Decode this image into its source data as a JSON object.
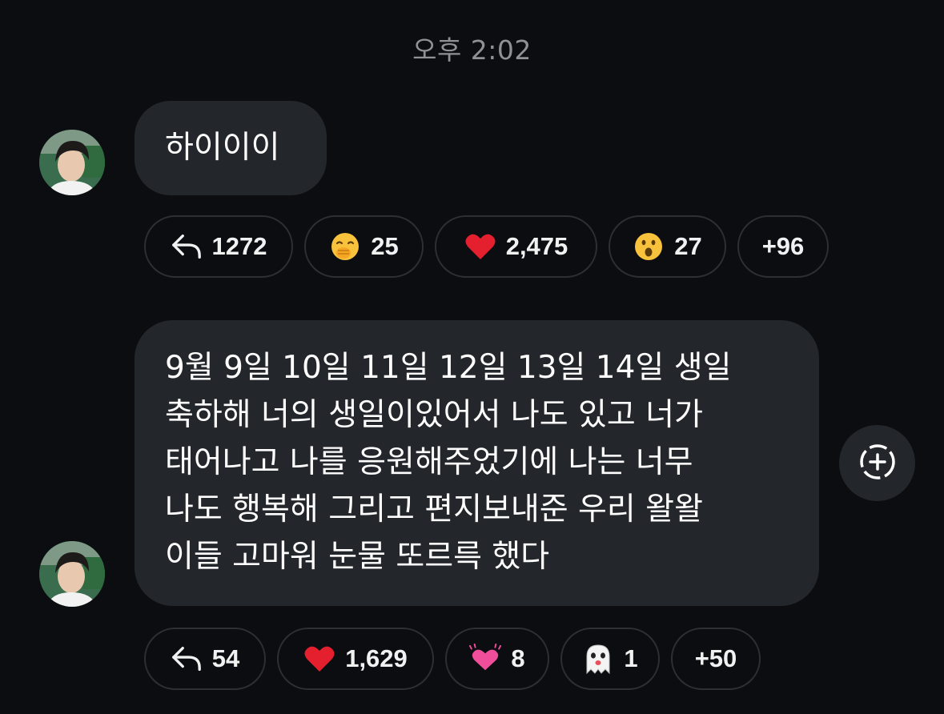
{
  "timestamp": "오후 2:02",
  "messages": [
    {
      "text": "하이이이",
      "reactions": [
        {
          "icon": "reply-arrow-icon",
          "count": "1272"
        },
        {
          "icon": "face-with-hand-over-mouth-emoji",
          "count": "25"
        },
        {
          "icon": "red-heart-emoji",
          "count": "2,475"
        },
        {
          "icon": "surprised-face-emoji",
          "count": "27"
        },
        {
          "icon": "",
          "count": "+96"
        }
      ]
    },
    {
      "lines": [
        "9월 9일 10일 11일 12일 13일 14일 생일",
        "축하해 너의 생일이있어서 나도 있고 너가",
        "태어나고 나를 응원해주었기에 나는 너무",
        "나도 행복해 그리고 편지보내준 우리 왈왈",
        "이들 고마워 눈물 또르륵 했다"
      ],
      "reactions": [
        {
          "icon": "reply-arrow-icon",
          "count": "54"
        },
        {
          "icon": "red-heart-emoji",
          "count": "1,629"
        },
        {
          "icon": "beating-heart-emoji",
          "count": "8"
        },
        {
          "icon": "ghost-emoji",
          "count": "1"
        },
        {
          "icon": "",
          "count": "+50"
        }
      ]
    }
  ],
  "colors": {
    "background": "#0b0d11",
    "bubble": "#23262b",
    "pill_border": "#2c2f34",
    "timestamp": "#8e9196"
  }
}
